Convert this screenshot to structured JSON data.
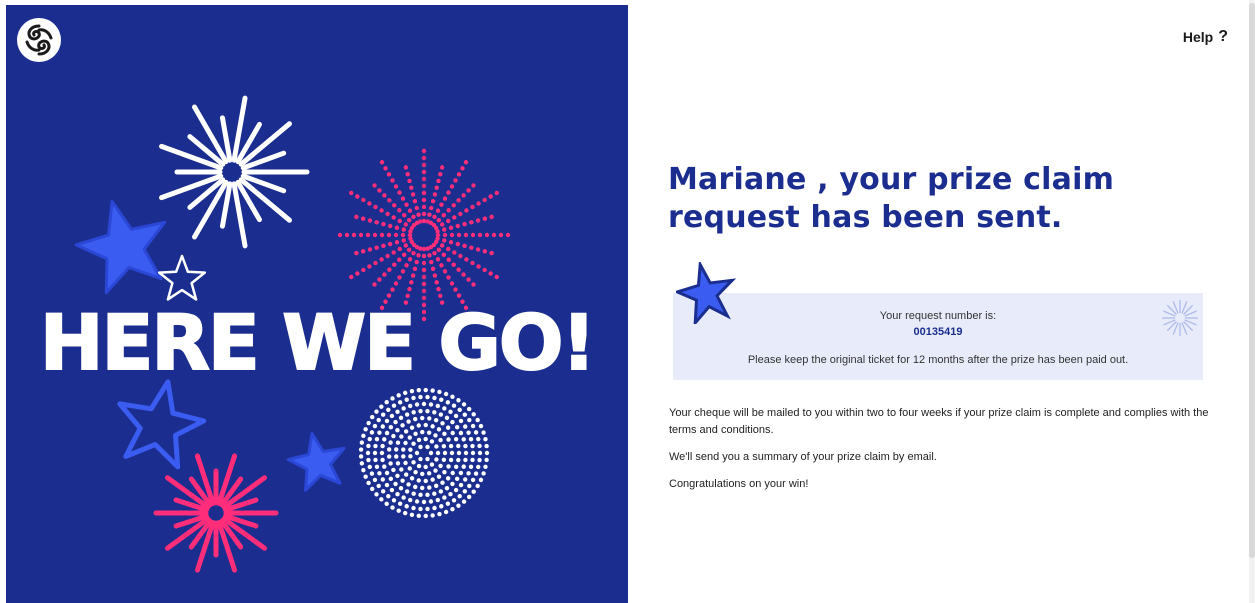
{
  "hero": {
    "title": "HERE WE GO!",
    "background_color": "#1b2e8f",
    "accent_pink": "#ff2d7a",
    "accent_star_blue": "#3a5cf0",
    "logo_icon": "swirl-logo-icon"
  },
  "header": {
    "help_label": "Help",
    "help_icon": "question-mark-icon"
  },
  "main": {
    "headline": "Mariane , your prize claim request has been sent.",
    "request": {
      "label": "Your request number is:",
      "number": "00135419",
      "note": "Please keep the original ticket for 12 months after the prize has been paid out."
    },
    "paragraphs": [
      "Your cheque will be mailed to you within two to four weeks if your prize claim is complete and complies with the terms and conditions.",
      "We'll send you a summary of your prize claim by email.",
      "Congratulations on your win!"
    ]
  }
}
